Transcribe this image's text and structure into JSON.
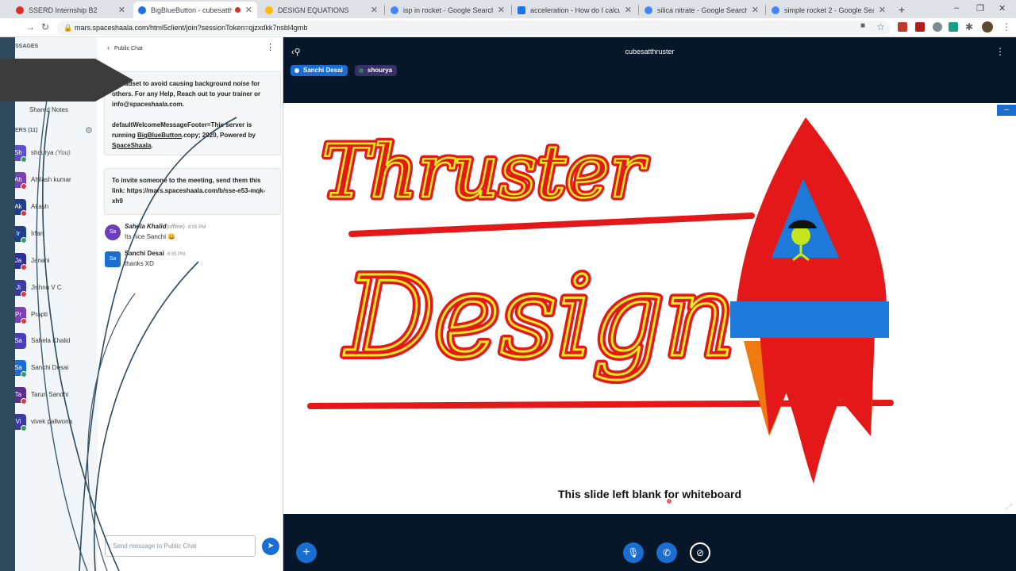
{
  "browser": {
    "tabs": [
      {
        "title": "SSERD Internship B2",
        "color": "#d93025"
      },
      {
        "title": "BigBlueButton - cubesatthru",
        "color": "#1a73e8"
      },
      {
        "title": "DESIGN EQUATIONS",
        "color": "#fbbc04"
      },
      {
        "title": "isp in rocket - Google Search",
        "color": "#4285f4"
      },
      {
        "title": "acceleration - How do I calculate",
        "color": "#1a73e8"
      },
      {
        "title": "silica nitrate - Google Search",
        "color": "#4285f4"
      },
      {
        "title": "simple rocket 2 - Google Search",
        "color": "#4285f4"
      }
    ],
    "url": "mars.spaceshaala.com/html5client/join?sessionToken=qjzxdkk7nsbl4gmb"
  },
  "userlist": {
    "messages_header": "SSAGES",
    "shared_notes": "Shared Notes",
    "users_header": "ERS (11)",
    "users": [
      {
        "initials": "Sh",
        "name": "shourya",
        "suffix": "(You)",
        "color": "#5a4fcf",
        "status": "#2e9e61"
      },
      {
        "initials": "Ah",
        "name": "Ahilash kumar",
        "suffix": "",
        "color": "#7c3fb4",
        "status": "#d9383a"
      },
      {
        "initials": "Ak",
        "name": "Akash",
        "suffix": "",
        "color": "#1f3f8b",
        "status": "#d9383a"
      },
      {
        "initials": "Ir",
        "name": "Irfan",
        "suffix": "",
        "color": "#1f3f8b",
        "status": "#2e9e61"
      },
      {
        "initials": "Ja",
        "name": "Janani",
        "suffix": "",
        "color": "#2f2f9c",
        "status": "#d9383a"
      },
      {
        "initials": "Ji",
        "name": "Jishnu V C",
        "suffix": "",
        "color": "#3a3aa0",
        "status": "#d9383a"
      },
      {
        "initials": "Pr",
        "name": "Prapti",
        "suffix": "",
        "color": "#7c3fb4",
        "status": "#d9383a"
      },
      {
        "initials": "Sa",
        "name": "Sahela Khalid",
        "suffix": "",
        "color": "#4a3fb4",
        "status": ""
      },
      {
        "initials": "Sa",
        "name": "Sanchi Desai",
        "suffix": "",
        "color": "#1b6ed1",
        "status": "#2e9e61"
      },
      {
        "initials": "Ta",
        "name": "Tarun Sandhi",
        "suffix": "",
        "color": "#5a2f8c",
        "status": "#d9383a"
      },
      {
        "initials": "Vi",
        "name": "vivek pallwona",
        "suffix": "",
        "color": "#3a3aa0",
        "status": "#2e9e61"
      }
    ]
  },
  "chat": {
    "title": "Public Chat",
    "welcome_text": "a headset to avoid causing background noise for others. For any Help, Reach out to your trainer or info@spaceshaala.com.",
    "footer_text_1": "defaultWelcomeMessageFooter=This server is running ",
    "footer_link_1": "BigBlueButton",
    "footer_text_2": ".copy; 2020, Powered by ",
    "footer_link_2": "SpaceShaala",
    "footer_text_3": ".",
    "invite_text": "To invite someone to the meeting, send them this link: https://mars.spaceshaala.com/b/sse-e53-mqk-xh9",
    "messages": [
      {
        "initials": "Sa",
        "name": "Sahela Khalid",
        "status": "(offline)",
        "time": "8:05 PM",
        "text": "Its nice Sanchi",
        "emoji": "😀",
        "color": "#6a3fb8"
      },
      {
        "initials": "Sa",
        "name": "Sanchi Desai",
        "status": "",
        "time": "8:05 PM",
        "text": "thanks XD",
        "emoji": "",
        "color": "#1b6ed1"
      }
    ],
    "input_placeholder": "Send message to Public Chat"
  },
  "stage": {
    "title": "cubesatthruster",
    "talkers": [
      {
        "name": "Sanchi Desai",
        "bg": "#1b6ed1",
        "dot": "#e8f0ff"
      },
      {
        "name": "shourya",
        "bg": "#3b2f6b",
        "dot": "#2e7d5b"
      }
    ],
    "slide_caption": "This slide left blank for whiteboard",
    "drawing_words": [
      "Thruster",
      "Design"
    ]
  }
}
